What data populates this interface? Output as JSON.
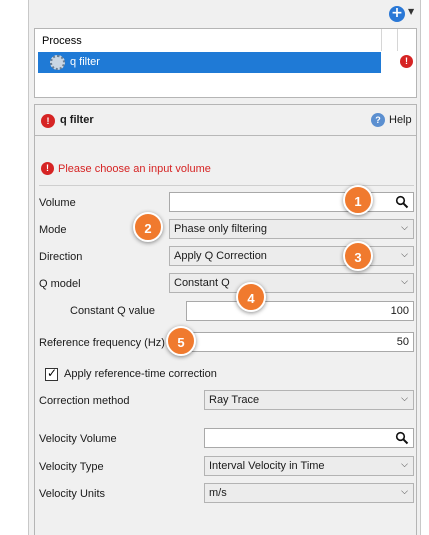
{
  "toolbar": {
    "add_icon": "plus-circle-icon",
    "dropdown_icon": "caret-down-icon"
  },
  "process_list": {
    "header": "Process",
    "items": [
      {
        "label": "q filter",
        "icon": "gear-icon",
        "status": "error"
      }
    ]
  },
  "properties": {
    "title": "q filter",
    "help_label": "Help",
    "warning": "Please choose an input volume",
    "volume": {
      "label": "Volume",
      "value": ""
    },
    "mode": {
      "label": "Mode",
      "value": "Phase only filtering"
    },
    "direction": {
      "label": "Direction",
      "value": "Apply Q Correction"
    },
    "q_model": {
      "label": "Q model",
      "value": "Constant Q"
    },
    "constant_q": {
      "label": "Constant Q value",
      "value": "100"
    },
    "reference_frequency": {
      "label": "Reference frequency (Hz)",
      "value": "50"
    },
    "apply_ref_time": {
      "label": "Apply reference-time correction",
      "checked": true
    },
    "correction_method": {
      "label": "Correction method",
      "value": "Ray Trace"
    },
    "velocity_volume": {
      "label": "Velocity Volume",
      "value": ""
    },
    "velocity_type": {
      "label": "Velocity Type",
      "value": "Interval Velocity in Time"
    },
    "velocity_units": {
      "label": "Velocity Units",
      "value": "m/s"
    }
  },
  "callouts": [
    "1",
    "2",
    "3",
    "4",
    "5"
  ],
  "colors": {
    "selection": "#1f7ad6",
    "error": "#d62424",
    "callout": "#f07a2e"
  }
}
